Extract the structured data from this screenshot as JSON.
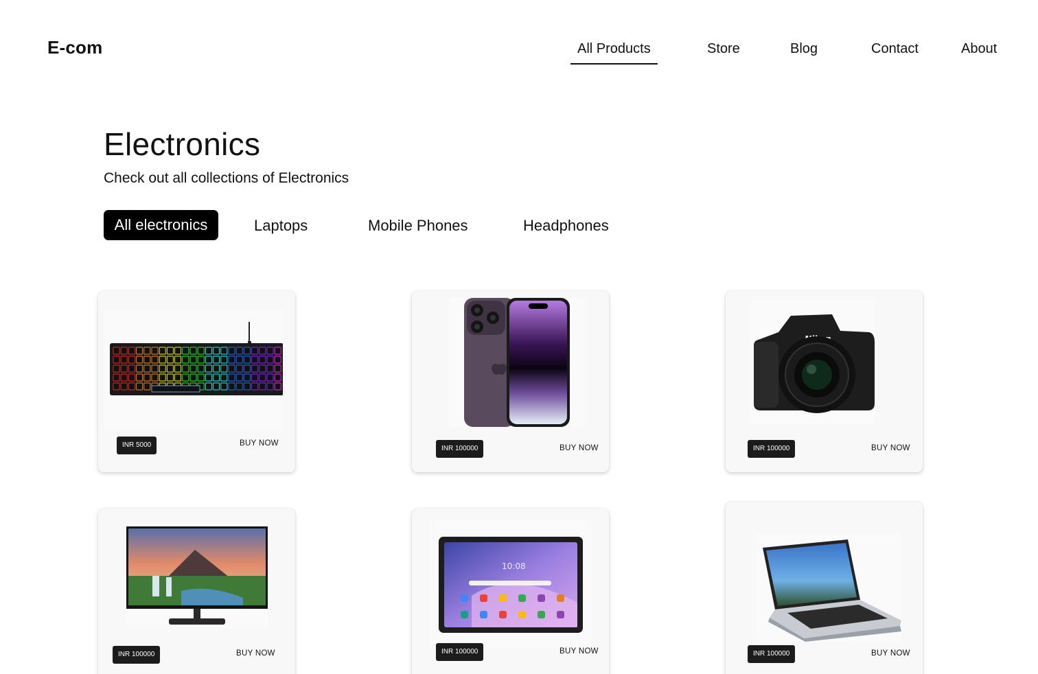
{
  "brand": "E-com",
  "nav": {
    "items": [
      "All Products",
      "Store",
      "Blog",
      "Contact",
      "About"
    ],
    "active": "All Products"
  },
  "hero": {
    "title": "Electronics",
    "subtitle": "Check out all collections of Electronics"
  },
  "filters": {
    "items": [
      "All electronics",
      "Laptops",
      "Mobile Phones",
      "Headphones"
    ],
    "active": "All electronics"
  },
  "products": [
    {
      "image": "keyboard-image",
      "price": "INR  5000",
      "cta": "BUY NOW"
    },
    {
      "image": "smartphone-image",
      "price": "INR 100000",
      "cta": "BUY NOW"
    },
    {
      "image": "camera-image",
      "price": "INR 100000",
      "cta": "BUY NOW"
    },
    {
      "image": "monitor-image",
      "price": "INR 100000",
      "cta": "BUY NOW"
    },
    {
      "image": "tablet-image",
      "price": "INR 100000",
      "cta": "BUY NOW"
    },
    {
      "image": "laptop-image",
      "price": "INR 100000",
      "cta": "BUY NOW"
    }
  ],
  "colors": {
    "accent": "#000000",
    "card_bg": "#f8f8f8",
    "price_badge_bg": "#1c1c1c"
  }
}
